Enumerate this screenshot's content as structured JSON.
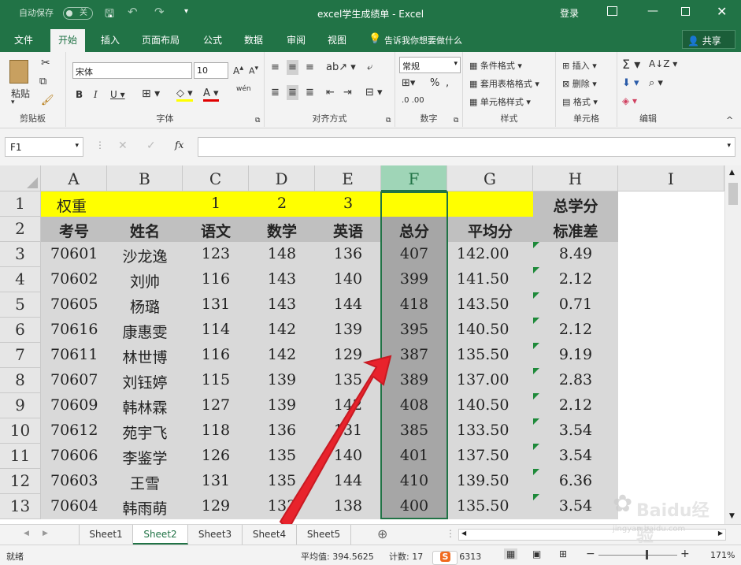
{
  "titlebar": {
    "autosave": "自动保存",
    "autosave_state": "关",
    "title": "excel学生成绩单 - Excel",
    "login": "登录"
  },
  "tabs": [
    "文件",
    "开始",
    "插入",
    "页面布局",
    "公式",
    "数据",
    "审阅",
    "视图"
  ],
  "tell_me": "告诉我你想要做什么",
  "share": "共享",
  "ribbon": {
    "clipboard": {
      "paste": "粘贴",
      "label": "剪贴板"
    },
    "font": {
      "name": "宋体",
      "size": "10",
      "label": "字体",
      "wen": "wén"
    },
    "align": {
      "label": "对齐方式"
    },
    "number": {
      "format": "常规",
      "label": "数字"
    },
    "styles": {
      "cond": "条件格式",
      "table": "套用表格格式",
      "cell": "单元格样式",
      "label": "样式"
    },
    "cells": {
      "insert": "插入",
      "delete": "删除",
      "format": "格式",
      "label": "单元格"
    },
    "editing": {
      "label": "编辑"
    }
  },
  "formula_bar": {
    "name_box": "F1",
    "fx": "fx",
    "value": ""
  },
  "columns": [
    "A",
    "B",
    "C",
    "D",
    "E",
    "F",
    "G",
    "H",
    "I"
  ],
  "rows": [
    "1",
    "2",
    "3",
    "4",
    "5",
    "6",
    "7",
    "8",
    "9",
    "10",
    "11",
    "12",
    "13"
  ],
  "header_row1": {
    "A": "权重",
    "C": "1",
    "D": "2",
    "E": "3",
    "F": "",
    "G": "",
    "H": "总学分"
  },
  "header_row2": {
    "A": "考号",
    "B": "姓名",
    "C": "语文",
    "D": "数学",
    "E": "英语",
    "F": "总分",
    "G": "平均分",
    "H": "标准差"
  },
  "records": [
    [
      "70601",
      "沙龙逸",
      "123",
      "148",
      "136",
      "407",
      "142.00",
      "8.49"
    ],
    [
      "70602",
      "刘帅",
      "116",
      "143",
      "140",
      "399",
      "141.50",
      "2.12"
    ],
    [
      "70605",
      "杨璐",
      "131",
      "143",
      "144",
      "418",
      "143.50",
      "0.71"
    ],
    [
      "70616",
      "康惠雯",
      "114",
      "142",
      "139",
      "395",
      "140.50",
      "2.12"
    ],
    [
      "70611",
      "林世博",
      "116",
      "142",
      "129",
      "387",
      "135.50",
      "9.19"
    ],
    [
      "70607",
      "刘钰婷",
      "115",
      "139",
      "135",
      "389",
      "137.00",
      "2.83"
    ],
    [
      "70609",
      "韩林霖",
      "127",
      "139",
      "142",
      "408",
      "140.50",
      "2.12"
    ],
    [
      "70612",
      "苑宇飞",
      "118",
      "136",
      "131",
      "385",
      "133.50",
      "3.54"
    ],
    [
      "70606",
      "李鉴学",
      "126",
      "135",
      "140",
      "401",
      "137.50",
      "3.54"
    ],
    [
      "70603",
      "王雪",
      "131",
      "135",
      "144",
      "410",
      "139.50",
      "6.36"
    ],
    [
      "70604",
      "韩雨萌",
      "129",
      "133",
      "138",
      "400",
      "135.50",
      "3.54"
    ]
  ],
  "sheets": [
    "Sheet1",
    "Sheet2",
    "Sheet3",
    "Sheet4",
    "Sheet5"
  ],
  "active_sheet": "Sheet2",
  "status": {
    "ready": "就绪",
    "average": "平均值: 394.5625",
    "count": "计数: 17",
    "sum": "求和: 6313",
    "zoom": "171%"
  },
  "watermark": {
    "text": "Baidu经验",
    "url": "jingyan.baidu.com"
  },
  "colors": {
    "accent": "#217346",
    "highlight": "#ffff00",
    "header_gray": "#c0c0c0",
    "selected_col": "#a6a6a6",
    "arrow": "#e8232c"
  }
}
